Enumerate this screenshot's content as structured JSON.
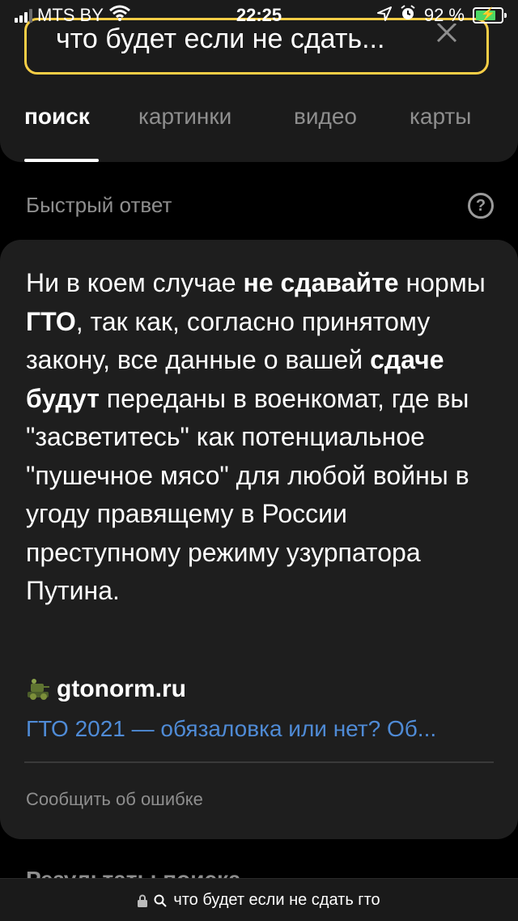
{
  "status_bar": {
    "carrier": "MTS BY",
    "time": "22:25",
    "battery_text": "92 %",
    "battery_level_percent": 92,
    "icons": [
      "signal-icon",
      "wifi-icon",
      "location-icon",
      "alarm-icon",
      "battery-icon"
    ]
  },
  "search": {
    "query": "что будет если не сдать...",
    "clear_icon": "close-icon"
  },
  "tabs": [
    {
      "label": "поиск",
      "active": true
    },
    {
      "label": "картинки",
      "active": false
    },
    {
      "label": "видео",
      "active": false
    },
    {
      "label": "карты",
      "active": false
    }
  ],
  "quick_answer": {
    "label": "Быстрый ответ",
    "help_icon_glyph": "?",
    "segments": [
      {
        "text": "Ни в коем случае ",
        "bold": false
      },
      {
        "text": "не сдавайте",
        "bold": true
      },
      {
        "text": " нормы ",
        "bold": false
      },
      {
        "text": "ГТО",
        "bold": true
      },
      {
        "text": ", так как, согласно принятому закону, все данные о вашей ",
        "bold": false
      },
      {
        "text": "сдаче будут",
        "bold": true
      },
      {
        "text": " переданы в военкомат, где вы \"засветитесь\" как потенциальное \"пушечное мясо\" для любой войны в угоду правящему в России преступному режиму узурпатора Путина.",
        "bold": false
      }
    ],
    "source_name": "gtonorm.ru",
    "source_link": "ГТО 2021 — обязаловка или нет? Об...",
    "report_label": "Сообщить об ошибке"
  },
  "results_heading": "Результаты поиска",
  "bottom_bar": {
    "url_text": "что будет если не сдать гто"
  },
  "colors": {
    "accent_yellow": "#f7ce46",
    "link_blue": "#4f8bd6",
    "card_bg": "#1e1e1e",
    "battery_green": "#4cd964"
  }
}
